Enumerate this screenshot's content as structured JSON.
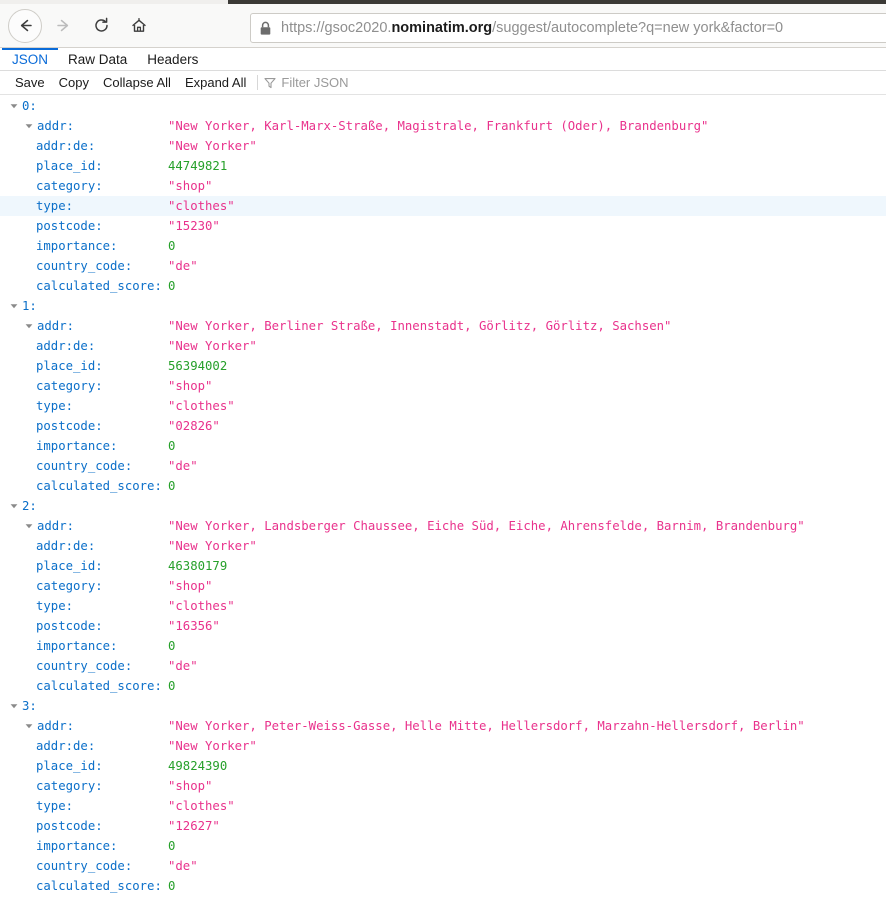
{
  "browser": {
    "nav": {
      "back_label": "Back",
      "forward_label": "Forward",
      "reload_label": "Reload",
      "home_label": "Home"
    },
    "url_bar": {
      "lock_icon": "lock-icon",
      "scheme_and_sub": "https://gsoc2020.",
      "domain": "nominatim.org",
      "path_and_query": "/suggest/autocomplete?q=new york&factor=0",
      "full_url": "https://gsoc2020.nominatim.org/suggest/autocomplete?q=new york&factor=0"
    }
  },
  "viewer": {
    "tabs": [
      {
        "label": "JSON",
        "active": true
      },
      {
        "label": "Raw Data",
        "active": false
      },
      {
        "label": "Headers",
        "active": false
      }
    ],
    "toolbar": {
      "save_label": "Save",
      "copy_label": "Copy",
      "collapse_all_label": "Collapse All",
      "expand_all_label": "Expand All",
      "filter_icon": "filter-funnel-icon",
      "filter_placeholder": "Filter JSON",
      "filter_value": ""
    }
  },
  "json": {
    "highlighted_row": {
      "index": 0,
      "key": "type"
    },
    "items": [
      {
        "index_label": "0:",
        "fields": [
          {
            "key": "addr:",
            "value": "\"New Yorker, Karl-Marx-Straße, Magistrale, Frankfurt (Oder), Brandenburg\"",
            "type": "string",
            "expandable": true
          },
          {
            "key": "addr:de:",
            "value": "\"New Yorker\"",
            "type": "string",
            "expandable": false
          },
          {
            "key": "place_id:",
            "value": "44749821",
            "type": "number",
            "expandable": false
          },
          {
            "key": "category:",
            "value": "\"shop\"",
            "type": "string",
            "expandable": false
          },
          {
            "key": "type:",
            "value": "\"clothes\"",
            "type": "string",
            "expandable": false
          },
          {
            "key": "postcode:",
            "value": "\"15230\"",
            "type": "string",
            "expandable": false
          },
          {
            "key": "importance:",
            "value": "0",
            "type": "number",
            "expandable": false
          },
          {
            "key": "country_code:",
            "value": "\"de\"",
            "type": "string",
            "expandable": false
          },
          {
            "key": "calculated_score:",
            "value": "0",
            "type": "number",
            "expandable": false
          }
        ]
      },
      {
        "index_label": "1:",
        "fields": [
          {
            "key": "addr:",
            "value": "\"New Yorker, Berliner Straße, Innenstadt, Görlitz, Görlitz, Sachsen\"",
            "type": "string",
            "expandable": true
          },
          {
            "key": "addr:de:",
            "value": "\"New Yorker\"",
            "type": "string",
            "expandable": false
          },
          {
            "key": "place_id:",
            "value": "56394002",
            "type": "number",
            "expandable": false
          },
          {
            "key": "category:",
            "value": "\"shop\"",
            "type": "string",
            "expandable": false
          },
          {
            "key": "type:",
            "value": "\"clothes\"",
            "type": "string",
            "expandable": false
          },
          {
            "key": "postcode:",
            "value": "\"02826\"",
            "type": "string",
            "expandable": false
          },
          {
            "key": "importance:",
            "value": "0",
            "type": "number",
            "expandable": false
          },
          {
            "key": "country_code:",
            "value": "\"de\"",
            "type": "string",
            "expandable": false
          },
          {
            "key": "calculated_score:",
            "value": "0",
            "type": "number",
            "expandable": false
          }
        ]
      },
      {
        "index_label": "2:",
        "fields": [
          {
            "key": "addr:",
            "value": "\"New Yorker, Landsberger Chaussee, Eiche Süd, Eiche, Ahrensfelde, Barnim, Brandenburg\"",
            "type": "string",
            "expandable": true
          },
          {
            "key": "addr:de:",
            "value": "\"New Yorker\"",
            "type": "string",
            "expandable": false
          },
          {
            "key": "place_id:",
            "value": "46380179",
            "type": "number",
            "expandable": false
          },
          {
            "key": "category:",
            "value": "\"shop\"",
            "type": "string",
            "expandable": false
          },
          {
            "key": "type:",
            "value": "\"clothes\"",
            "type": "string",
            "expandable": false
          },
          {
            "key": "postcode:",
            "value": "\"16356\"",
            "type": "string",
            "expandable": false
          },
          {
            "key": "importance:",
            "value": "0",
            "type": "number",
            "expandable": false
          },
          {
            "key": "country_code:",
            "value": "\"de\"",
            "type": "string",
            "expandable": false
          },
          {
            "key": "calculated_score:",
            "value": "0",
            "type": "number",
            "expandable": false
          }
        ]
      },
      {
        "index_label": "3:",
        "fields": [
          {
            "key": "addr:",
            "value": "\"New Yorker, Peter-Weiss-Gasse, Helle Mitte, Hellersdorf, Marzahn-Hellersdorf, Berlin\"",
            "type": "string",
            "expandable": true
          },
          {
            "key": "addr:de:",
            "value": "\"New Yorker\"",
            "type": "string",
            "expandable": false
          },
          {
            "key": "place_id:",
            "value": "49824390",
            "type": "number",
            "expandable": false
          },
          {
            "key": "category:",
            "value": "\"shop\"",
            "type": "string",
            "expandable": false
          },
          {
            "key": "type:",
            "value": "\"clothes\"",
            "type": "string",
            "expandable": false
          },
          {
            "key": "postcode:",
            "value": "\"12627\"",
            "type": "string",
            "expandable": false
          },
          {
            "key": "importance:",
            "value": "0",
            "type": "number",
            "expandable": false
          },
          {
            "key": "country_code:",
            "value": "\"de\"",
            "type": "string",
            "expandable": false
          },
          {
            "key": "calculated_score:",
            "value": "0",
            "type": "number",
            "expandable": false
          }
        ]
      }
    ]
  },
  "colors": {
    "key": "#0b6fc9",
    "string": "#e9328c",
    "number": "#26a02a",
    "accent": "#0a6bd8",
    "row_highlight": "#eff7fd"
  }
}
